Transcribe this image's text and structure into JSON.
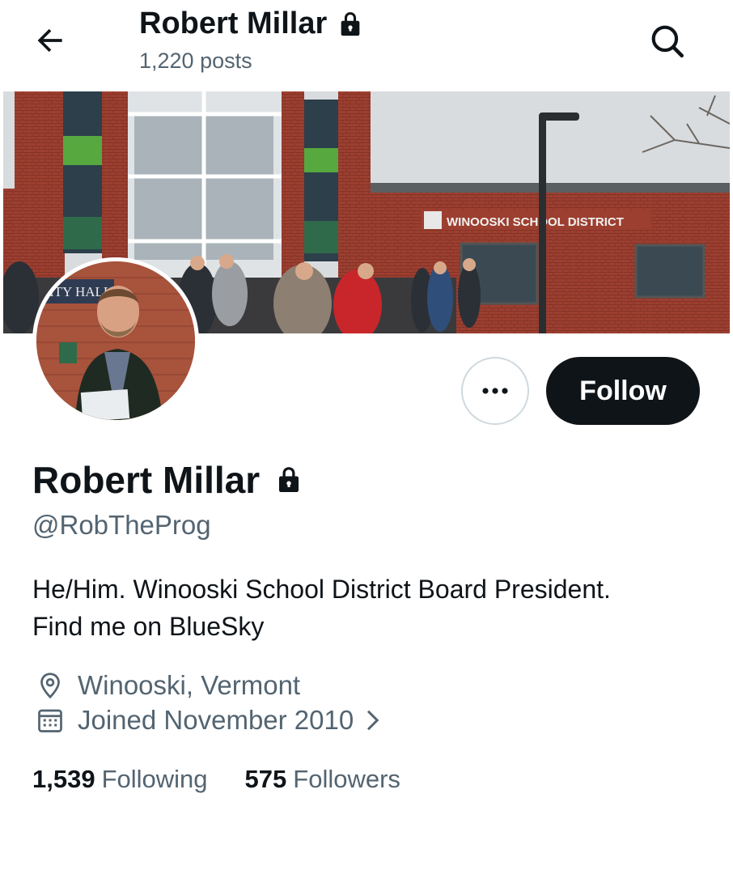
{
  "header": {
    "name": "Robert Millar",
    "posts": "1,220 posts",
    "back_icon": "arrow-left-icon",
    "search_icon": "search-icon"
  },
  "banner": {
    "sign_text": "WINOOSKI SCHOOL DISTRICT"
  },
  "avatar": {
    "sign_text": "ITY HALL"
  },
  "actions": {
    "more_icon": "more-horizontal-icon",
    "follow_label": "Follow"
  },
  "profile": {
    "display_name": "Robert Millar",
    "protected_icon": "lock-icon",
    "handle": "@RobTheProg",
    "bio_line1": "He/Him. Winooski School District Board President.",
    "bio_line2": "Find me on BlueSky",
    "location": "Winooski, Vermont",
    "joined": "Joined November 2010",
    "location_icon": "location-pin-icon",
    "calendar_icon": "calendar-icon"
  },
  "stats": {
    "following_count": "1,539",
    "following_label": "Following",
    "followers_count": "575",
    "followers_label": "Followers"
  },
  "colors": {
    "text_primary": "#0f1419",
    "text_secondary": "#536471",
    "button_dark": "#0f1419",
    "border": "#cfd9de"
  }
}
